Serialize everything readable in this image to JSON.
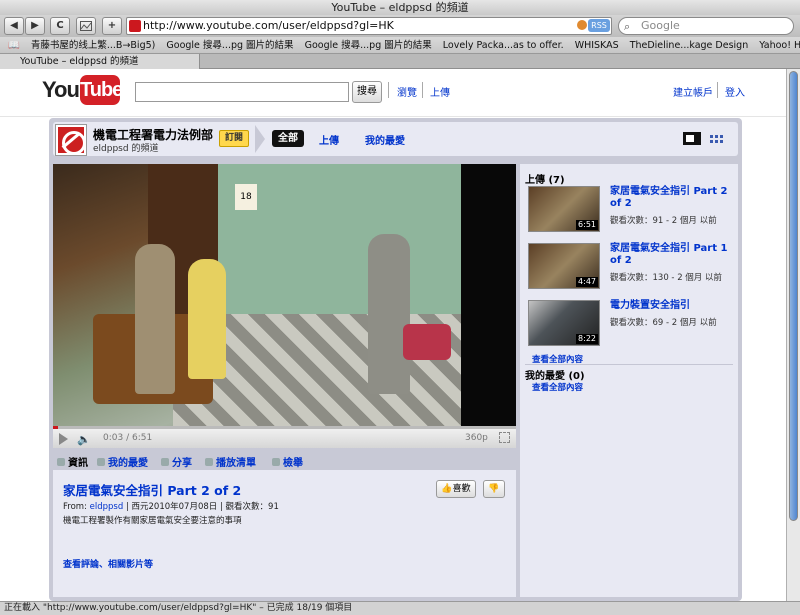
{
  "window": {
    "title": "YouTube – eldppsd 的頻道"
  },
  "browser": {
    "back_label": "◀",
    "forward_label": "▶",
    "reload_label": "C",
    "add_label": "+",
    "url": "http://www.youtube.com/user/eldppsd?gl=HK",
    "rss_label": "RSS",
    "search_placeholder": "Google",
    "bookmarks": [
      "青藤书屋的线上繁...B→Big5)",
      "Google 搜尋...pg 圖片的結果",
      "Google 搜尋...pg 圖片的結果",
      "Lovely Packa...as to offer.",
      "WHISKAS",
      "TheDieline...kage Design",
      "Yahoo! Hon...ng – 雅虎香港"
    ],
    "tab_label": "YouTube – eldppsd 的頻道",
    "status": "正在載入 \"http://www.youtube.com/user/eldppsd?gl=HK\" – 已完成 18/19 個項目"
  },
  "header": {
    "logo_you": "You",
    "logo_tube": "Tube",
    "search_button": "搜尋",
    "browse": "瀏覽",
    "upload": "上傳",
    "create_account": "建立帳戶",
    "login": "登入"
  },
  "channel": {
    "title": "機電工程署電力法例部",
    "subtitle": "eldppsd 的頻道",
    "subscribe": "訂閱",
    "tab_all": "全部",
    "tab_uploads": "上傳",
    "tab_favorites": "我的最愛"
  },
  "player": {
    "time": "0:03 / 6:51",
    "quality": "360p",
    "progress": 0.01,
    "calendar": "18"
  },
  "video_tabs": {
    "info": "資訊",
    "favorites": "我的最愛",
    "share": "分享",
    "playlists": "播放清單",
    "flag": "檢舉"
  },
  "video": {
    "title": "家居電氣安全指引 Part 2 of 2",
    "from_label": "From:",
    "author": "eldppsd",
    "meta_rest": "| 西元2010年07月08日 | 觀看次數：91",
    "description": "機電工程署製作有關家居電氣安全要注意的事項",
    "like": "喜歡",
    "more_link": "查看評論、相關影片等"
  },
  "sidebar": {
    "uploads_heading": "上傳 (7)",
    "uploads": [
      {
        "title": "家居電氣安全指引 Part 2 of 2",
        "meta": "觀看次數：91 - 2 個月 以前",
        "duration": "6:51"
      },
      {
        "title": "家居電氣安全指引 Part 1 of 2",
        "meta": "觀看次數：130 - 2 個月 以前",
        "duration": "4:47"
      },
      {
        "title": "電力裝置安全指引",
        "meta": "觀看次數：69 - 2 個月 以前",
        "duration": "8:22"
      }
    ],
    "see_all": "查看全部內容",
    "favorites_heading": "我的最愛 (0)",
    "favorites_see_all": "查看全部內容"
  }
}
